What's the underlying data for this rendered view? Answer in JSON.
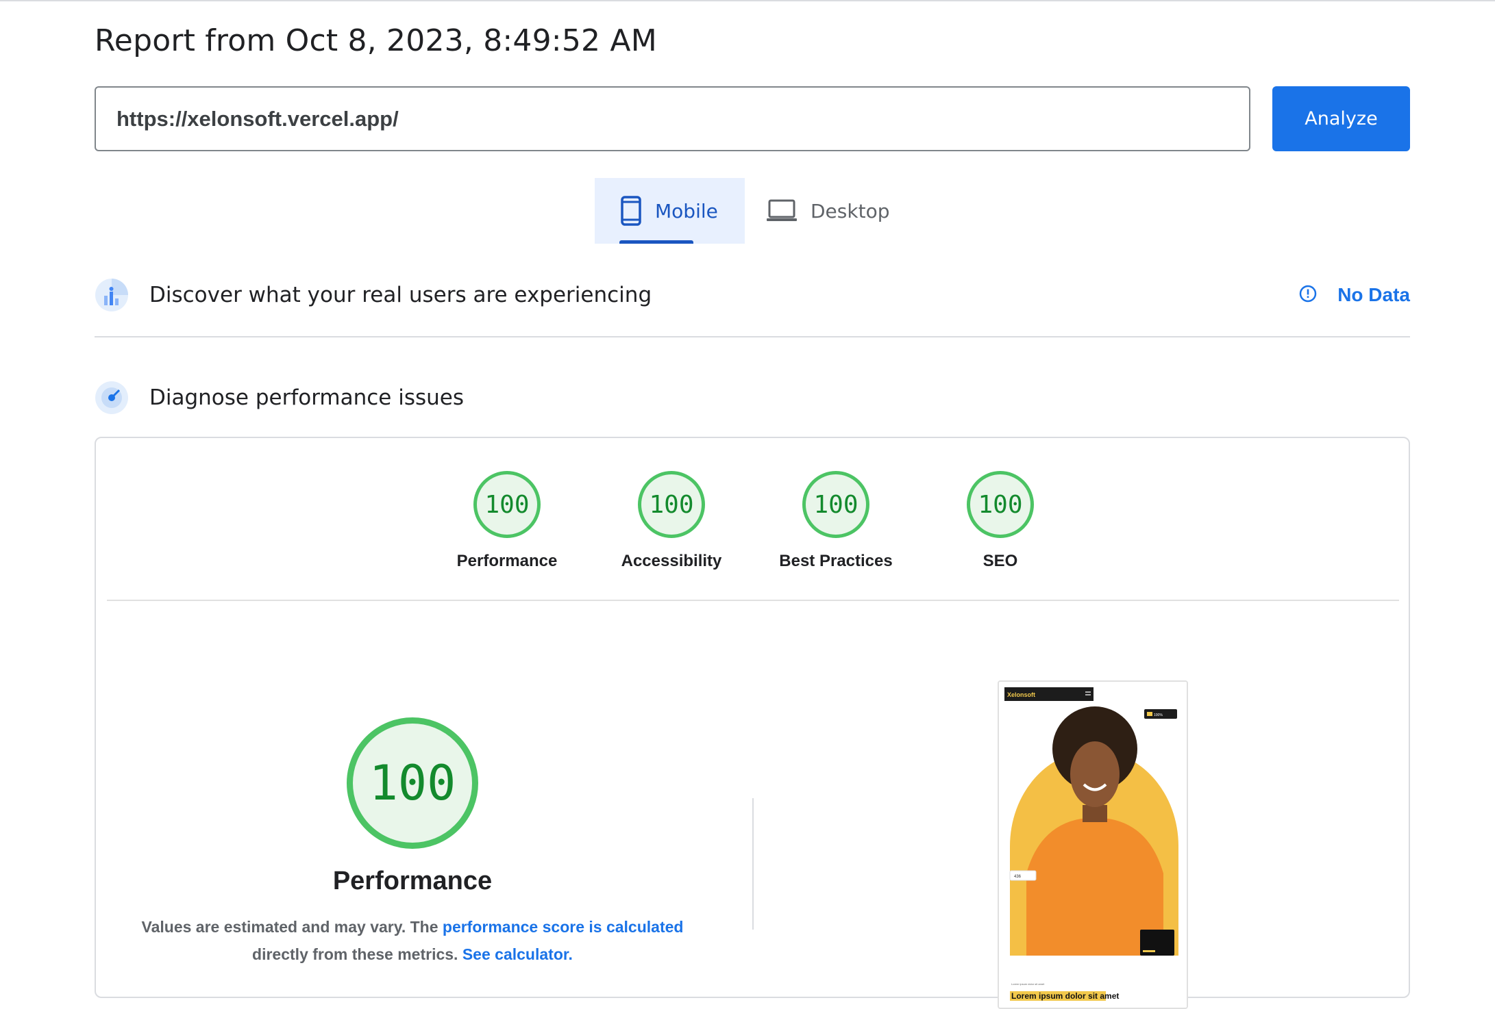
{
  "report": {
    "title": "Report from Oct 8, 2023, 8:49:52 AM"
  },
  "search": {
    "url": "https://xelonsoft.vercel.app/",
    "analyze_label": "Analyze"
  },
  "tabs": [
    {
      "label": "Mobile",
      "icon": "smartphone-icon",
      "active": true
    },
    {
      "label": "Desktop",
      "icon": "laptop-icon",
      "active": false
    }
  ],
  "field_data": {
    "title": "Discover what your real users are experiencing",
    "status": "No Data",
    "status_icon": "info-icon"
  },
  "diagnose": {
    "title": "Diagnose performance issues"
  },
  "scores": [
    {
      "label": "Performance",
      "value": "100"
    },
    {
      "label": "Accessibility",
      "value": "100"
    },
    {
      "label": "Best Practices",
      "value": "100"
    },
    {
      "label": "SEO",
      "value": "100"
    }
  ],
  "performance": {
    "score": "100",
    "title": "Performance",
    "text_1": "Values are estimated and may vary. The ",
    "link_1": "performance score is calculated",
    "text_2": "directly from these metrics. ",
    "link_2": "See calculator."
  },
  "screenshot": {
    "brand": "Xelonsoft",
    "rating_label": "100%",
    "small_badge": "436",
    "caption_small": "Lorem ipsum dolor sit amet",
    "caption_highlight": "Lorem ipsum dolor",
    "caption_rest": " sit amet"
  },
  "colors": {
    "accent": "#1a73e8",
    "pass": "#4cc464",
    "pass_text": "#138a2d",
    "pass_bg": "#e9f6ea"
  }
}
